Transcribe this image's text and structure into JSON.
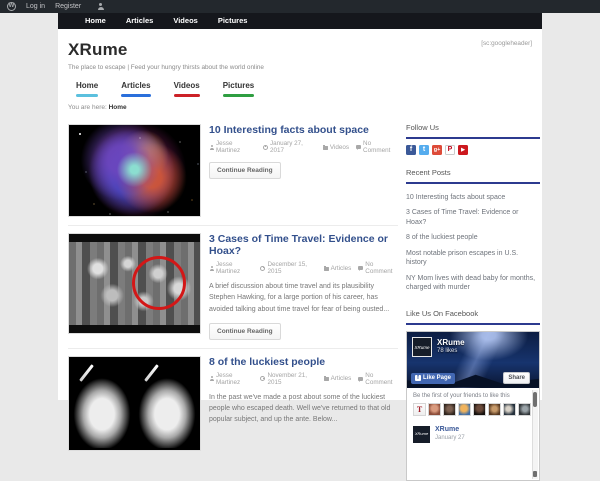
{
  "admin_bar": {
    "login": "Log in",
    "register": "Register"
  },
  "navbar": {
    "items": [
      "Home",
      "Articles",
      "Videos",
      "Pictures"
    ]
  },
  "header": {
    "site_title": "XRume",
    "tagline": "The place to escape | Feed your hungry thirsts about the world online",
    "header_shortcode": "[sc:googleheader]"
  },
  "subnav": {
    "items": [
      {
        "label": "Home",
        "underline_color": "#5bc0de"
      },
      {
        "label": "Articles",
        "underline_color": "#2a6fdb"
      },
      {
        "label": "Videos",
        "underline_color": "#cc2127"
      },
      {
        "label": "Pictures",
        "underline_color": "#2f9e41"
      }
    ]
  },
  "breadcrumb": {
    "prefix": "You are here:",
    "current": "Home"
  },
  "posts": [
    {
      "title": "10 Interesting facts about space",
      "author": "Jesse Martinez",
      "date": "January 27, 2017",
      "category": "Videos",
      "comments": "No Comment",
      "excerpt": "",
      "button": "Continue Reading",
      "image": "supernova-nebula-photo"
    },
    {
      "title": "3 Cases of Time Travel: Evidence or Hoax?",
      "author": "Jesse Martinez",
      "date": "December 15, 2015",
      "category": "Articles",
      "comments": "No Comment",
      "excerpt": "A brief discussion about time travel and its plausibility Stephen Hawking, for a large portion of his career, has avoided talking about time travel for fear of being ousted...",
      "button": "Continue Reading",
      "image": "bw-crowd-red-circle-photo"
    },
    {
      "title": "8 of the luckiest people",
      "author": "Jesse Martinez",
      "date": "November 21, 2015",
      "category": "Articles",
      "comments": "No Comment",
      "excerpt": "In the past we've made a post about some of the luckiest people who escaped death. Well we've returned to that old popular subject, and up the ante. Below...",
      "image": "skull-xray-photo"
    }
  ],
  "sidebar": {
    "follow_us": {
      "title": "Follow Us",
      "icons": [
        "facebook-icon",
        "twitter-icon",
        "googleplus-icon",
        "pinterest-icon",
        "youtube-icon"
      ],
      "glyphs": {
        "facebook": "f",
        "twitter": "t",
        "googleplus": "g+",
        "pinterest": "P",
        "youtube": "▶"
      }
    },
    "recent_posts": {
      "title": "Recent Posts",
      "items": [
        "10 Interesting facts about space",
        "3 Cases of Time Travel: Evidence or Hoax?",
        "8 of the luckiest people",
        "Most notable prison escapes in U.S. history",
        "NY Mom lives with dead baby for months, charged with murder"
      ]
    },
    "facebook": {
      "title": "Like Us On Facebook",
      "page_name": "XRume",
      "logo_text": "XRume",
      "likes": "78 likes",
      "like_button": "Like Page",
      "share_button": "Share",
      "invite_text": "Be the first of your friends to like this",
      "post_author": "XRume",
      "post_date": "January 27"
    }
  },
  "colors": {
    "admin_bar_bg": "#23282d",
    "navbar_bg": "#15171c",
    "post_title_link": "#33508c",
    "widget_underline": "#2c3a8f",
    "facebook_blue": "#4267b2"
  }
}
